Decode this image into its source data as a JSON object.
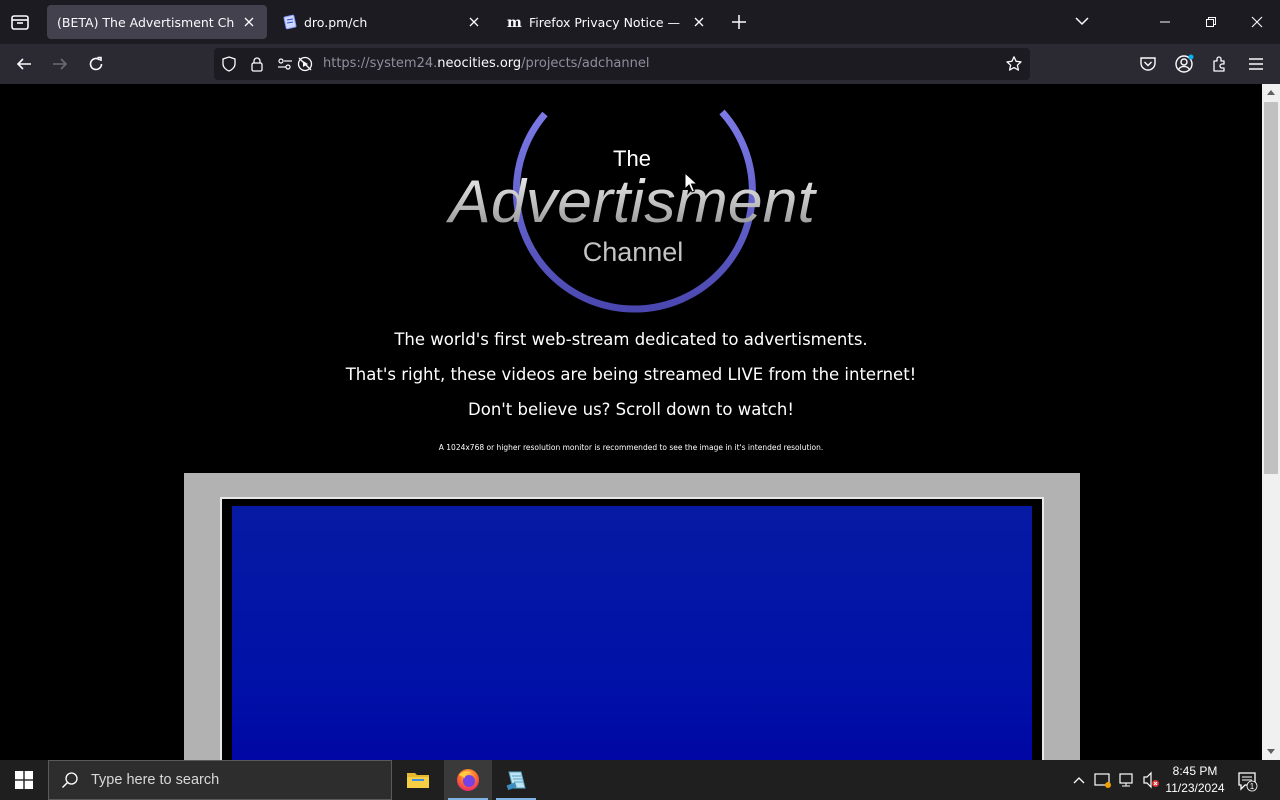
{
  "browser": {
    "tabs": [
      {
        "title": "(BETA) The Advertisment Channel",
        "active": true
      },
      {
        "title": "dro.pm/ch",
        "active": false
      },
      {
        "title": "Firefox Privacy Notice — Mozill",
        "active": false
      }
    ],
    "url": {
      "prefix": "https://system24.",
      "host": "neocities.org",
      "path": "/projects/adchannel"
    }
  },
  "page": {
    "logo": {
      "the": "The",
      "main": "Advertisment",
      "channel": "Channel"
    },
    "taglines": [
      "The world's first web-stream dedicated to advertisments.",
      "That's right, these videos are being streamed LIVE from the internet!",
      "Don't believe us? Scroll down to watch!"
    ],
    "note": "A 1024x768 or higher resolution monitor is recommended to see the image in it's intended resolution."
  },
  "taskbar": {
    "search_placeholder": "Type here to search",
    "time": "8:45 PM",
    "date": "11/23/2024",
    "notification_count": "1"
  },
  "colors": {
    "ring": "#6a68d8",
    "screen_blue": "#0011a8",
    "tab_active": "#42414d"
  }
}
